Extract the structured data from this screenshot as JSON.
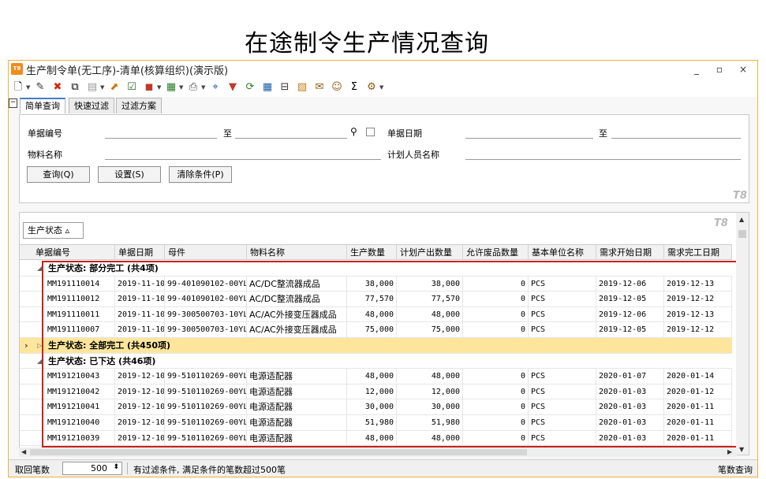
{
  "slide_title": "在途制令生产情况查询",
  "window": {
    "title": "生产制令单(无工序)-清单(核算组织)(演示版)",
    "app_badge": "T8",
    "controls": {
      "minimize": "_",
      "maximize": "▫",
      "close": "×"
    }
  },
  "tabs": [
    "简单查询",
    "快速过滤",
    "过滤方案"
  ],
  "filter": {
    "doc_no_label": "单据编号",
    "to_label": "至",
    "doc_date_label": "单据日期",
    "to_label2": "至",
    "material_label": "物料名称",
    "planner_label": "计划人员名称",
    "buttons": {
      "query": "查询(Q)",
      "settings": "设置(S)",
      "clear": "清除条件(P)"
    }
  },
  "watermark": "T8",
  "grid": {
    "group_by_label": "生产状态 ▵",
    "columns": [
      "单据编号",
      "单据日期",
      "母件",
      "物料名称",
      "生产数量",
      "计划产出数量",
      "允许废品数量",
      "基本单位名称",
      "需求开始日期",
      "需求完工日期"
    ],
    "groups": [
      {
        "label": "生产状态: 部分完工 (共4项)",
        "expanded": true,
        "rows": [
          [
            "MM191110014",
            "2019-11-10",
            "99-401090102-00YL",
            "AC/DC整流器成品",
            "38,000",
            "38,000",
            "0",
            "PCS",
            "2019-12-06",
            "2019-12-13"
          ],
          [
            "MM191110012",
            "2019-11-10",
            "99-401090102-00YL",
            "AC/DC整流器成品",
            "77,570",
            "77,570",
            "0",
            "PCS",
            "2019-12-05",
            "2019-12-12"
          ],
          [
            "MM191110011",
            "2019-11-10",
            "99-300500703-10YL",
            "AC/AC外接变压器成品",
            "48,000",
            "48,000",
            "0",
            "PCS",
            "2019-12-06",
            "2019-12-13"
          ],
          [
            "MM191110007",
            "2019-11-10",
            "99-300500703-10YL",
            "AC/AC外接变压器成品",
            "75,000",
            "75,000",
            "0",
            "PCS",
            "2019-12-05",
            "2019-12-12"
          ]
        ]
      },
      {
        "label": "生产状态: 全部完工 (共450项)",
        "expanded": false,
        "rows": []
      },
      {
        "label": "生产状态: 已下达 (共46项)",
        "expanded": true,
        "rows": [
          [
            "MM191210043",
            "2019-12-10",
            "99-510110269-00YL",
            "电源适配器",
            "48,000",
            "48,000",
            "0",
            "PCS",
            "2020-01-07",
            "2020-01-14"
          ],
          [
            "MM191210042",
            "2019-12-10",
            "99-510110269-00YL",
            "电源适配器",
            "12,000",
            "12,000",
            "0",
            "PCS",
            "2020-01-03",
            "2020-01-12"
          ],
          [
            "MM191210041",
            "2019-12-10",
            "99-510110269-00YL",
            "电源适配器",
            "30,000",
            "30,000",
            "0",
            "PCS",
            "2020-01-03",
            "2020-01-11"
          ],
          [
            "MM191210040",
            "2019-12-10",
            "99-510110269-00YL",
            "电源适配器",
            "51,980",
            "51,980",
            "0",
            "PCS",
            "2020-01-03",
            "2020-01-11"
          ],
          [
            "MM191210039",
            "2019-12-10",
            "99-510110269-00YL",
            "电源适配器",
            "48,000",
            "48,000",
            "0",
            "PCS",
            "2020-01-03",
            "2020-01-11"
          ]
        ]
      }
    ]
  },
  "status": {
    "fetch_label": "取回笔数",
    "fetch_value": "500",
    "message": "有过滤条件, 满足条件的笔数超过500笔",
    "right_label": "笔数查询"
  },
  "colors": {
    "accent": "#f0b03a",
    "group_highlight": "#fde69b",
    "red_box": "#c9211e"
  },
  "icons": [
    "new-doc-icon",
    "edit-icon",
    "delete-icon",
    "copy-icon",
    "paste-icon",
    "export-icon",
    "approve-icon",
    "stop-icon",
    "report-icon",
    "print-icon",
    "locate-icon",
    "filter-icon",
    "refresh-icon",
    "grid-icon",
    "exit-icon",
    "calc-icon",
    "mail-icon",
    "chat-icon",
    "sum-icon",
    "settings-icon"
  ]
}
